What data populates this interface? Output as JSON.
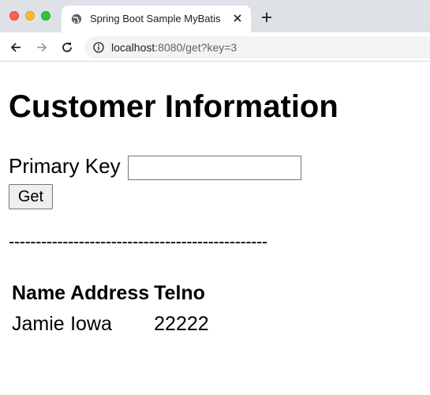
{
  "browser": {
    "tab": {
      "title": "Spring Boot Sample MyBatis"
    },
    "address": {
      "host": "localhost",
      "rest": ":8080/get?key=3"
    }
  },
  "page": {
    "heading": "Customer Information",
    "form": {
      "key_label": "Primary Key",
      "key_value": "",
      "button_label": "Get"
    },
    "divider": "------------------------------------------------",
    "table": {
      "headers": [
        "Name",
        "Address",
        "Telno"
      ],
      "rows": [
        [
          "Jamie",
          "Iowa",
          "22222"
        ]
      ]
    }
  }
}
